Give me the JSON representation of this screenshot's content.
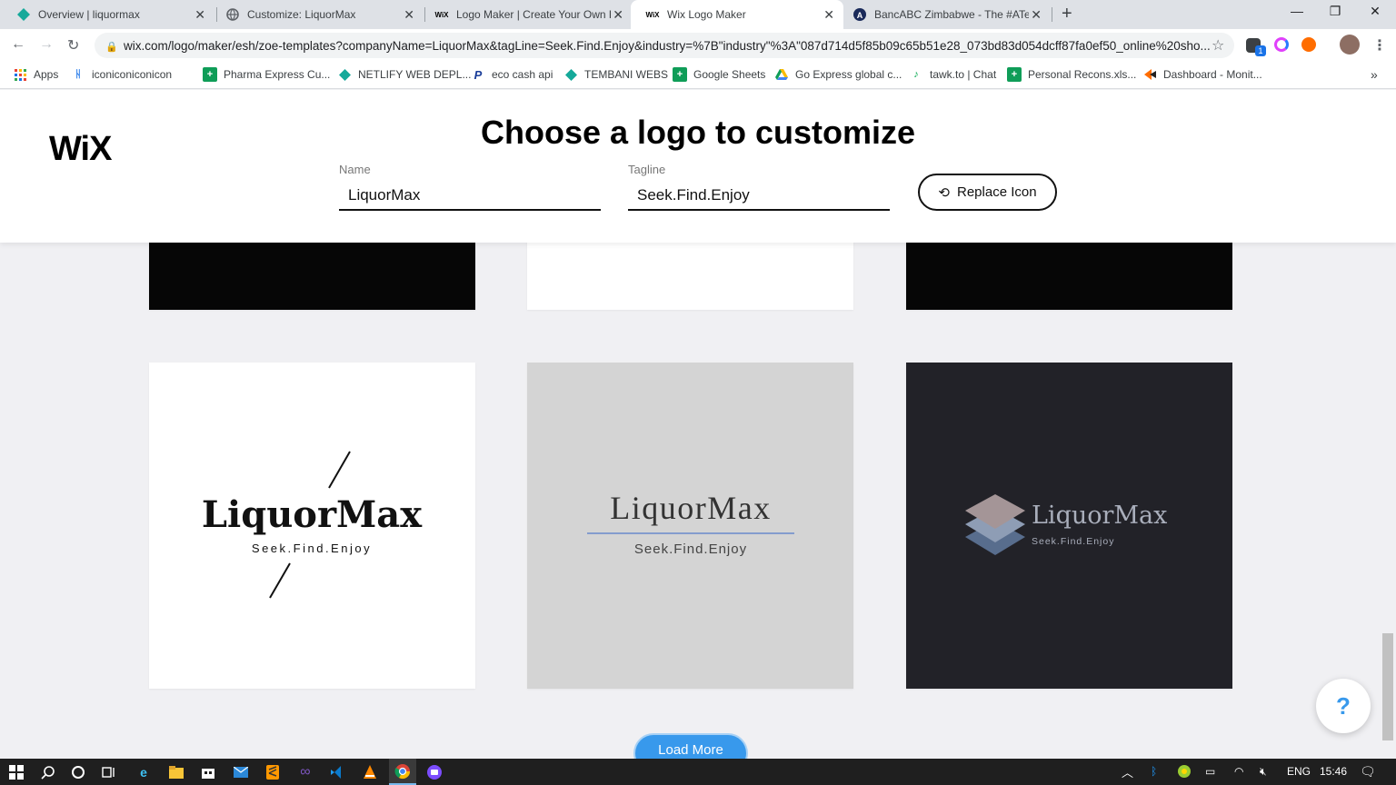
{
  "browser": {
    "tabs": [
      {
        "title": "Overview | liquormax",
        "icon": "netlify-icon",
        "active": false
      },
      {
        "title": "Customize: LiquorMax",
        "icon": "globe-icon",
        "active": false
      },
      {
        "title": "Logo Maker | Create Your Own Fr",
        "icon": "wix-icon",
        "active": false
      },
      {
        "title": "Wix Logo Maker",
        "icon": "wix-icon",
        "active": true
      },
      {
        "title": "BancABC Zimbabwe - The #ATea",
        "icon": "bancabc-icon",
        "active": false
      }
    ],
    "new_tab": "+",
    "url": "wix.com/logo/maker/esh/zoe-templates?companyName=LiquorMax&tagLine=Seek.Find.Enjoy&industry=%7B\"industry\"%3A\"087d714d5f85b09c65b51e28_073bd83d054dcff87fa0ef50_online%20sho...",
    "bookmarks": [
      {
        "label": "Apps",
        "icon": "apps-grid-icon"
      },
      {
        "label": "iconiconiconicon",
        "icon": "iconicon-icon"
      },
      {
        "label": "Pharma Express Cu...",
        "icon": "sheets-icon"
      },
      {
        "label": "NETLIFY WEB DEPL...",
        "icon": "netlify-icon"
      },
      {
        "label": "eco cash api",
        "icon": "paypal-icon"
      },
      {
        "label": "TEMBANI WEBS",
        "icon": "netlify-icon"
      },
      {
        "label": "Google Sheets",
        "icon": "sheets-icon"
      },
      {
        "label": "Go Express global c...",
        "icon": "drive-icon"
      },
      {
        "label": "tawk.to | Chat",
        "icon": "tawk-icon"
      },
      {
        "label": "Personal Recons.xls...",
        "icon": "sheets-icon"
      },
      {
        "label": "Dashboard - Monit...",
        "icon": "dashboard-icon"
      }
    ],
    "bookmarks_overflow": "»",
    "extension_badge": "1"
  },
  "page": {
    "brand": "WiX",
    "headline": "Choose a logo to customize",
    "name_label": "Name",
    "name_value": "LiquorMax",
    "tagline_label": "Tagline",
    "tagline_value": "Seek.Find.Enjoy",
    "replace_icon_label": "Replace Icon",
    "load_more_label": "Load More",
    "help_label": "?",
    "logos": [
      {
        "name": "LiquorMax",
        "tagline": "Seek.Find.Enjoy",
        "style": "slash-serif-bold",
        "bg": "#ffffff"
      },
      {
        "name": "LiquorMax",
        "tagline": "Seek.Find.Enjoy",
        "style": "smallcaps-underline",
        "bg": "#d4d4d4"
      },
      {
        "name": "LiquorMax",
        "tagline": "Seek.Find.Enjoy",
        "style": "stack-icon",
        "bg": "#222228"
      }
    ],
    "top_cards_bg": [
      "#060606",
      "#ffffff",
      "#060606"
    ]
  },
  "taskbar": {
    "language": "ENG",
    "time": "15:46"
  },
  "colors": {
    "accent": "#3899ec",
    "tab_strip": "#dee1e6"
  }
}
